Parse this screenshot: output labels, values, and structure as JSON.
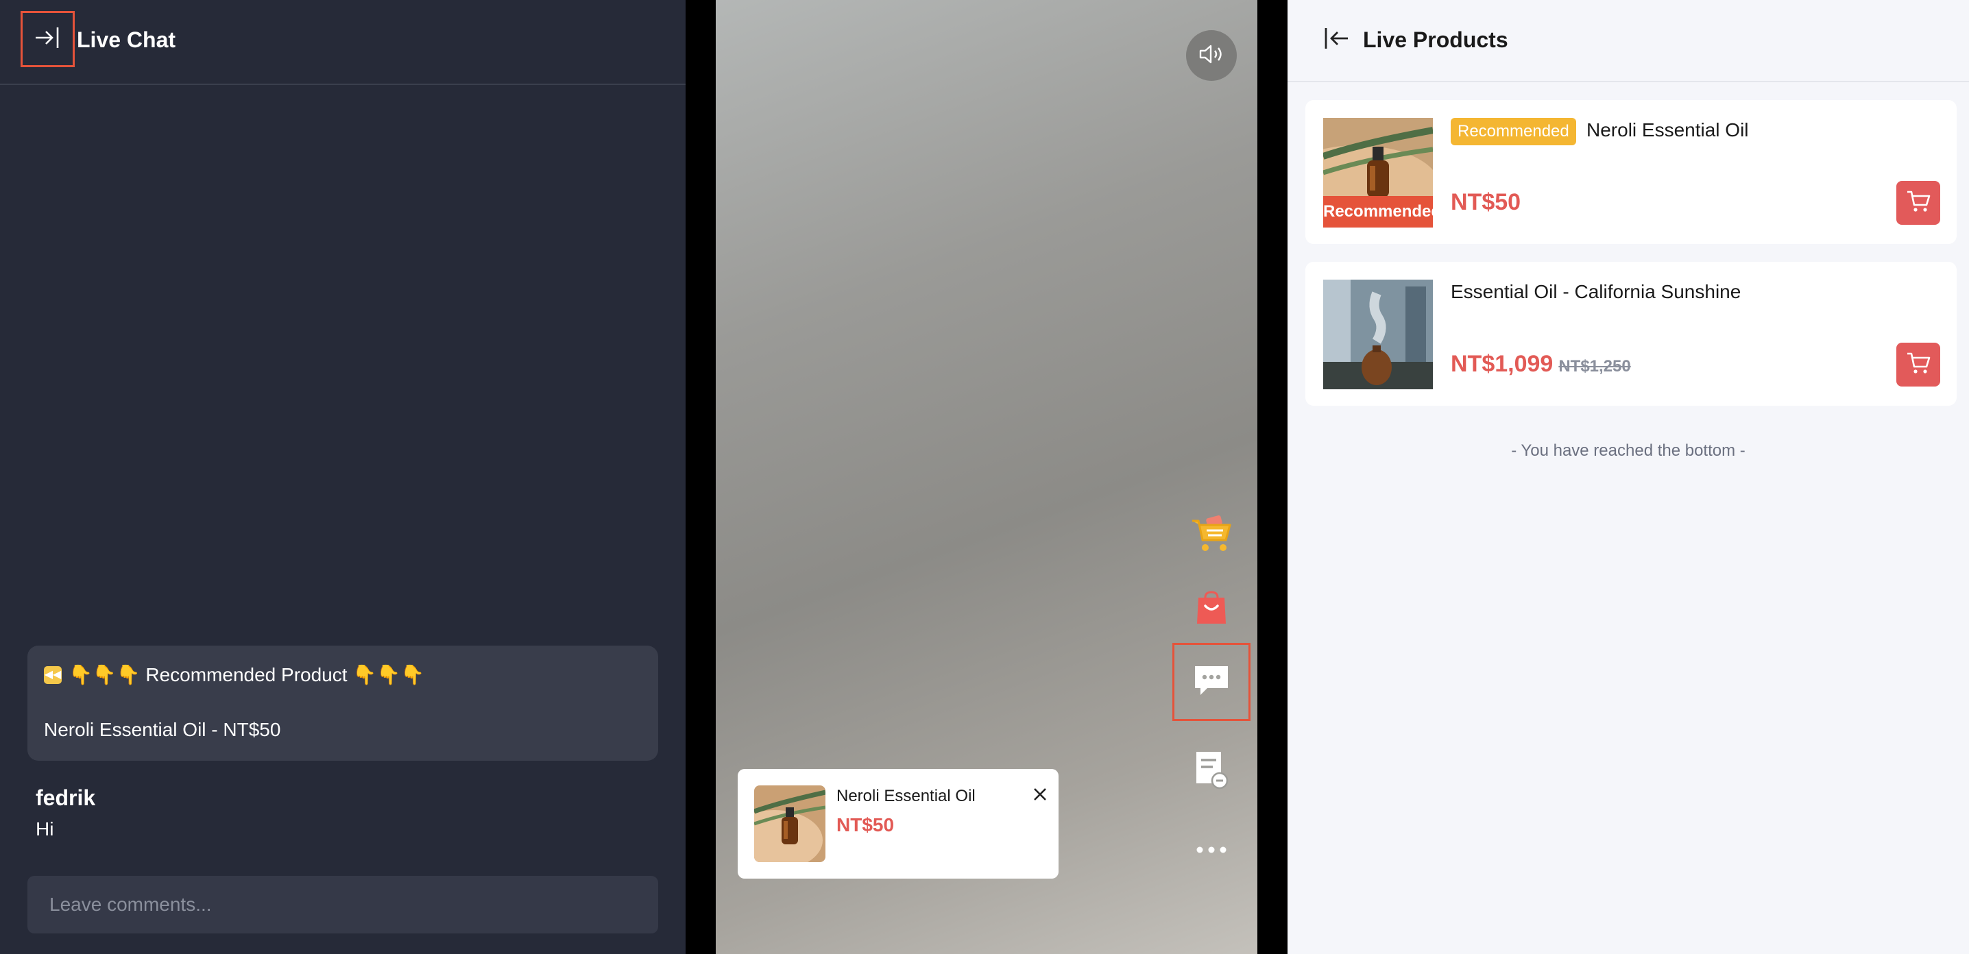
{
  "chat": {
    "title": "Live Chat",
    "pinned": {
      "line1": "👇👇👇 Recommended Product 👇👇👇",
      "line2": "Neroli Essential Oil - NT$50"
    },
    "message": {
      "user": "fedrik",
      "text": "Hi"
    },
    "comment_placeholder": "Leave comments..."
  },
  "video": {
    "popup": {
      "name": "Neroli Essential Oil",
      "price": "NT$50"
    },
    "side_icons": [
      "shopping-cart-icon",
      "shopping-bag-icon",
      "chat-bubble-icon",
      "notes-icon",
      "more-icon"
    ]
  },
  "products": {
    "title": "Live Products",
    "items": [
      {
        "tag": "Recommended",
        "image_badge": "Recommended",
        "name": "Neroli Essential Oil",
        "price": "NT$50",
        "original_price": ""
      },
      {
        "tag": "",
        "image_badge": "",
        "name": "Essential Oil - California Sunshine",
        "price": "NT$1,099",
        "original_price": "NT$1,250"
      }
    ],
    "bottom_note": "- You have reached the bottom -"
  },
  "colors": {
    "accent_red": "#e25a55",
    "highlight_border": "#e5533a",
    "tag_yellow": "#f4b632",
    "chat_bg": "#262a38"
  }
}
